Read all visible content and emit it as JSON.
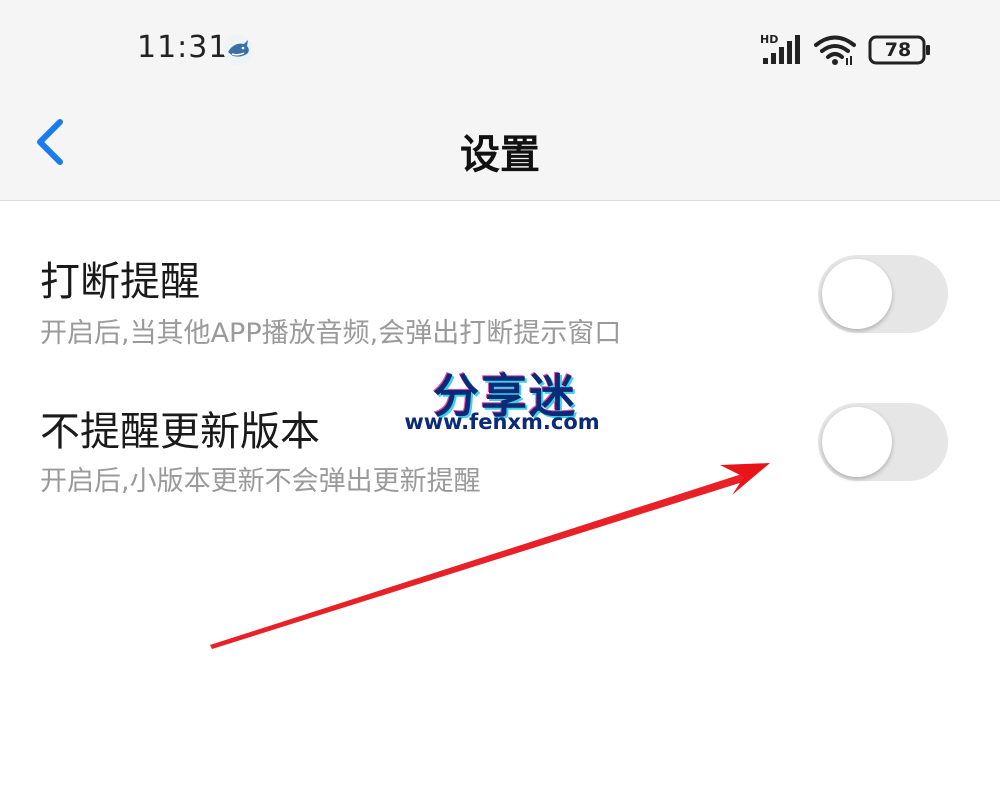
{
  "status_bar": {
    "time": "11:31",
    "network_type": "HD",
    "battery_level": "78",
    "app_icon": "shark-app-icon",
    "signal_icon": "cellular-signal-icon",
    "wifi_icon": "wifi-icon"
  },
  "header": {
    "title": "设置",
    "back_icon": "chevron-left-icon",
    "accent_color": "#1a7cf0"
  },
  "settings": [
    {
      "title": "打断提醒",
      "description": "开启后,当其他APP播放音频,会弹出打断提示窗口",
      "enabled": false
    },
    {
      "title": "不提醒更新版本",
      "description": "开启后,小版本更新不会弹出更新提醒",
      "enabled": false
    }
  ],
  "watermark": {
    "title": "分享迷",
    "url": "www.fenxm.com"
  },
  "annotation": {
    "arrow_color": "#e8141a"
  }
}
